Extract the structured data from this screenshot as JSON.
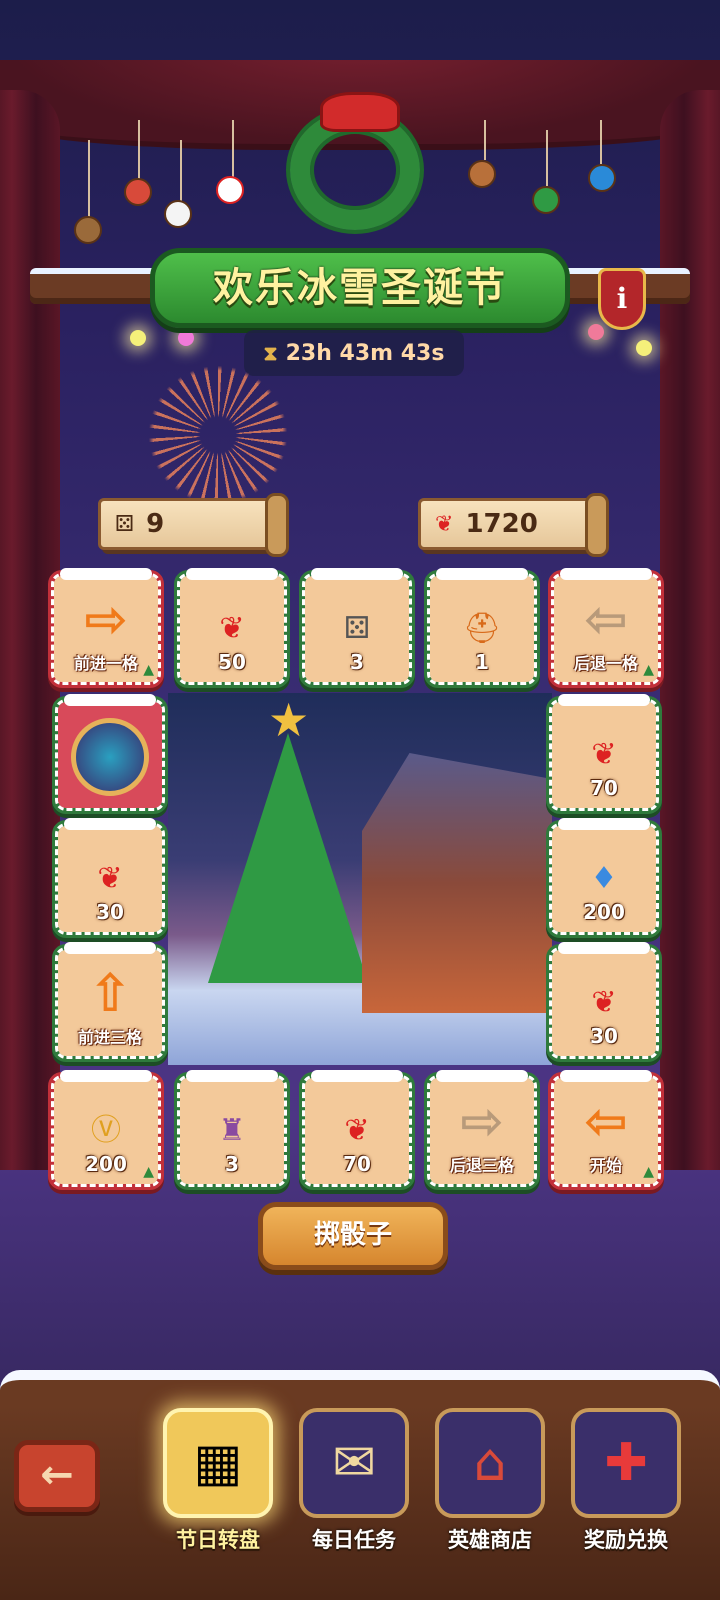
{
  "event": {
    "title": "欢乐冰雪圣诞节",
    "timer": "23h 43m 43s",
    "info_label": "i"
  },
  "counters": {
    "dice": "9",
    "candy": "1720"
  },
  "board": {
    "top": [
      {
        "icon": "forward-arrow-icon",
        "label": "前进一格",
        "corner": true
      },
      {
        "icon": "candy-cane-icon",
        "label": "50"
      },
      {
        "icon": "dice-icon",
        "label": "3"
      },
      {
        "icon": "hero-helmet-icon",
        "label": "1"
      },
      {
        "icon": "back-arrow-icon",
        "label": "后退一格",
        "corner": true
      }
    ],
    "left": [
      {
        "icon": "player-avatar",
        "label": ""
      },
      {
        "icon": "candy-cane-icon",
        "label": "30"
      },
      {
        "icon": "up-arrow-icon",
        "label": "前进三格"
      }
    ],
    "right": [
      {
        "icon": "candy-cane-icon",
        "label": "70"
      },
      {
        "icon": "diamond-icon",
        "label": "200"
      },
      {
        "icon": "candy-cane-icon",
        "label": "30"
      }
    ],
    "bottom": [
      {
        "icon": "v-coin-icon",
        "label": "200",
        "corner": true
      },
      {
        "icon": "loot-bag-icon",
        "label": "3"
      },
      {
        "icon": "candy-cane-icon",
        "label": "70"
      },
      {
        "icon": "right-arrow-icon",
        "label": "后退三格"
      },
      {
        "icon": "start-arrow-icon",
        "label": "开始",
        "corner": true
      }
    ]
  },
  "roll_button": "掷骰子",
  "nav": {
    "back": "←",
    "items": [
      {
        "label": "节日转盘",
        "icon": "board-game-icon",
        "active": true
      },
      {
        "label": "每日任务",
        "icon": "scroll-icon",
        "active": false
      },
      {
        "label": "英雄商店",
        "icon": "shop-icon",
        "active": false
      },
      {
        "label": "奖励兑换",
        "icon": "gift-icon",
        "active": false
      }
    ]
  }
}
